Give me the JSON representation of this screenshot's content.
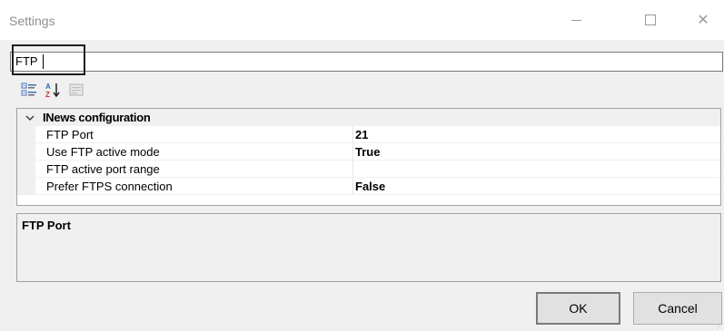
{
  "window": {
    "title": "Settings",
    "minimize_icon": "minimize-icon",
    "maximize_icon": "maximize-icon",
    "close_icon": "close-icon"
  },
  "search": {
    "value": "FTP",
    "placeholder": ""
  },
  "toolbar": {
    "icons": [
      "categorized-icon",
      "alphabetical-sort-icon",
      "property-pages-icon"
    ]
  },
  "grid": {
    "category": {
      "label": "INews configuration",
      "expanded": true
    },
    "properties": [
      {
        "name": "FTP Port",
        "value": "21"
      },
      {
        "name": "Use FTP active mode",
        "value": "True"
      },
      {
        "name": "FTP active port range",
        "value": ""
      },
      {
        "name": "Prefer FTPS connection",
        "value": "False"
      }
    ]
  },
  "description": {
    "title": "FTP Port",
    "text": ""
  },
  "buttons": {
    "ok": "OK",
    "cancel": "Cancel"
  },
  "colors": {
    "background": "#f0f0f0",
    "grid_background": "#ffffff",
    "border": "#a0a0a0"
  }
}
